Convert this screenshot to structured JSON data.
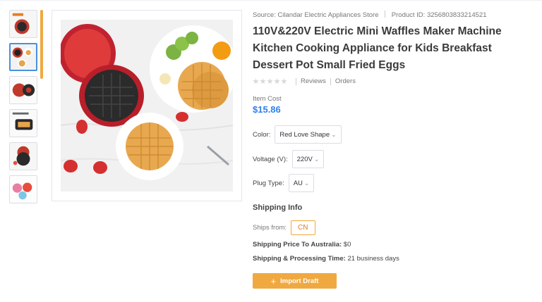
{
  "product": {
    "source_label": "Source:",
    "source_name": "Cilandar Electric Appliances Store",
    "product_id_label": "Product ID:",
    "product_id": "3256803833214521",
    "title": "110V&220V Electric Mini Waffles Maker Machine Kitchen Cooking Appliance for Kids Breakfast Dessert Pot Small Fried Eggs",
    "rating_stars": 0,
    "reviews_label": "Reviews",
    "orders_label": "Orders",
    "item_cost_label": "Item Cost",
    "item_cost_value": "$15.86"
  },
  "gallery": {
    "thumbnail_count": 6,
    "active_index": 1
  },
  "options": {
    "color": {
      "label": "Color:",
      "value": "Red Love Shape"
    },
    "voltage": {
      "label": "Voltage (V):",
      "value": "220V"
    },
    "plug": {
      "label": "Plug Type:",
      "value": "AU"
    }
  },
  "shipping": {
    "heading": "Shipping Info",
    "ships_from_label": "Ships from:",
    "ships_from_value": "CN",
    "price_label": "Shipping Price To Australia:",
    "price_value": "$0",
    "time_label": "Shipping & Processing Time:",
    "time_value": "21 business days"
  },
  "actions": {
    "import_label": "Import Draft"
  },
  "colors": {
    "accent": "#f0a940",
    "price": "#2f80ed",
    "active_thumb": "#4a90e2"
  },
  "icons": {
    "chevron": "chevron-down-icon",
    "plus": "plus-icon",
    "star": "star-icon"
  }
}
